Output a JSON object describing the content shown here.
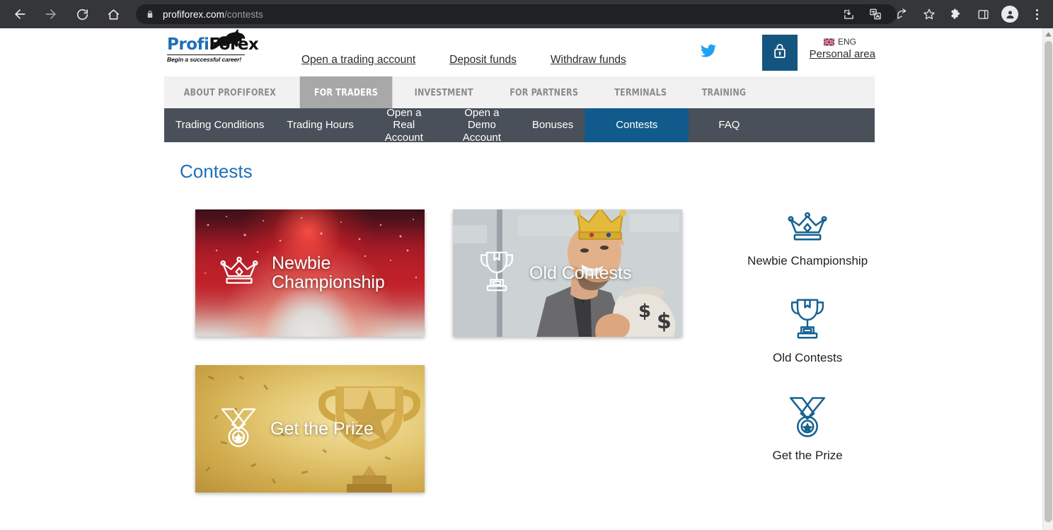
{
  "browser": {
    "url_domain": "profiforex.com",
    "url_path": "/contests",
    "back_icon": "back-arrow-icon",
    "forward_icon": "forward-arrow-icon",
    "reload_icon": "reload-icon",
    "home_icon": "home-icon",
    "lock_icon": "lock-icon",
    "install_icon": "install-app-icon",
    "translate_icon": "translate-icon",
    "share_icon": "share-icon",
    "bookmark_icon": "star-bookmark-icon",
    "extensions_icon": "puzzle-extensions-icon",
    "sidepanel_icon": "side-panel-icon",
    "profile_icon": "profile-avatar-icon",
    "menu_icon": "kebab-menu-icon"
  },
  "site": {
    "logo": {
      "part1": "Profi",
      "part2": "Forex",
      "tagline": "Begin a successful career!",
      "mark": "bull-logo-icon"
    },
    "header_links": [
      {
        "label": "Open a trading account"
      },
      {
        "label": "Deposit funds"
      },
      {
        "label": "Withdraw funds"
      }
    ],
    "twitter_icon": "twitter-bird-icon",
    "lock_button_icon": "padlock-icon",
    "language": "ENG",
    "flag_icon": "uk-flag-icon",
    "personal_area": "Personal area"
  },
  "nav_main": {
    "items": [
      {
        "label": "ABOUT PROFIFOREX",
        "active": false
      },
      {
        "label": "FOR TRADERS",
        "active": true
      },
      {
        "label": "INVESTMENT",
        "active": false
      },
      {
        "label": "FOR PARTNERS",
        "active": false
      },
      {
        "label": "TERMINALS",
        "active": false
      },
      {
        "label": "TRAINING",
        "active": false
      }
    ],
    "active_bg": "#a8a8a8",
    "bar_bg": "#f1f1f1"
  },
  "nav_sub": {
    "items": [
      {
        "label": "Trading Conditions",
        "active": false
      },
      {
        "label": "Trading Hours",
        "active": false
      },
      {
        "label": "Open a Real Account",
        "active": false
      },
      {
        "label": "Open a Demo Account",
        "active": false
      },
      {
        "label": "Bonuses",
        "active": false
      },
      {
        "label": "Contests",
        "active": true
      },
      {
        "label": "FAQ",
        "active": false
      }
    ],
    "active_bg": "#115b8c",
    "bar_bg": "#4a5059"
  },
  "page": {
    "title": "Contests",
    "title_color": "#1f6fb8"
  },
  "cards": [
    {
      "label": "Newbie Championship",
      "icon": "crown-icon",
      "theme": "red-sparkle"
    },
    {
      "label": "Old Contests",
      "icon": "trophy-icon",
      "theme": "photo-king"
    },
    {
      "label": "Get the Prize",
      "icon": "medal-icon",
      "theme": "gold-trophy"
    }
  ],
  "sidebar": {
    "items": [
      {
        "label": "Newbie Championship",
        "icon": "crown-icon"
      },
      {
        "label": "Old Contests",
        "icon": "trophy-icon"
      },
      {
        "label": "Get the Prize",
        "icon": "medal-icon"
      }
    ],
    "icon_color": "#16628f"
  }
}
